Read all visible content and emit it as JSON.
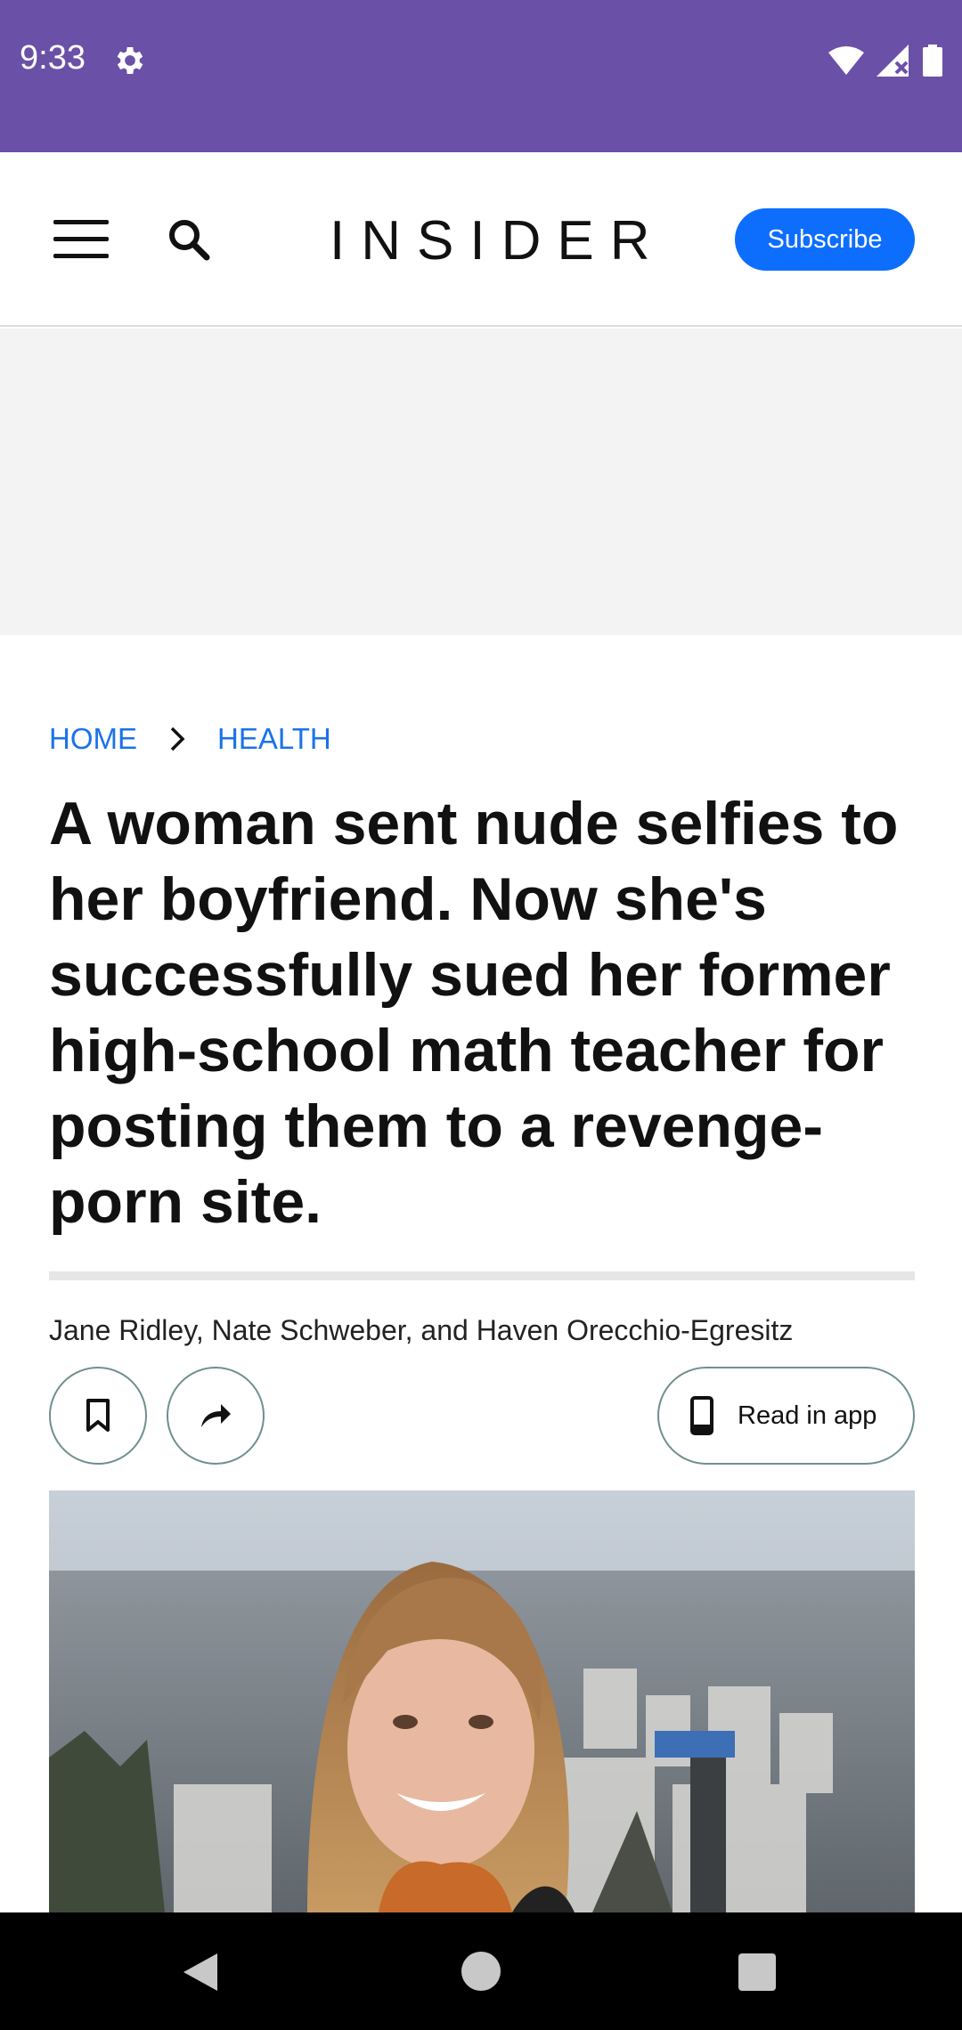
{
  "status_bar": {
    "time": "9:33",
    "icons": [
      "gear-icon",
      "wifi-icon",
      "signal-icon",
      "battery-icon"
    ],
    "background": "#6a50a7"
  },
  "header": {
    "menu_icon": "hamburger-menu-icon",
    "search_icon": "search-icon",
    "logo": "INSIDER",
    "subscribe_label": "Subscribe",
    "accent_color": "#0d6efd"
  },
  "breadcrumb": {
    "items": [
      "HOME",
      "HEALTH"
    ],
    "separator_icon": "chevron-right-icon"
  },
  "article": {
    "headline": "A woman sent nude selfies to her boyfriend. Now she's successfully sued her former high-school math teacher for posting them to a revenge-porn site.",
    "byline": "Jane Ridley, Nate Schweber, and Haven Orecchio-Egresitz"
  },
  "actions": {
    "bookmark_icon": "bookmark-icon",
    "share_icon": "share-arrow-icon",
    "read_in_app_icon": "phone-icon",
    "read_in_app_label": "Read in app"
  },
  "navigation_bar": {
    "icons": [
      "back-icon",
      "home-icon",
      "recent-apps-icon"
    ]
  }
}
